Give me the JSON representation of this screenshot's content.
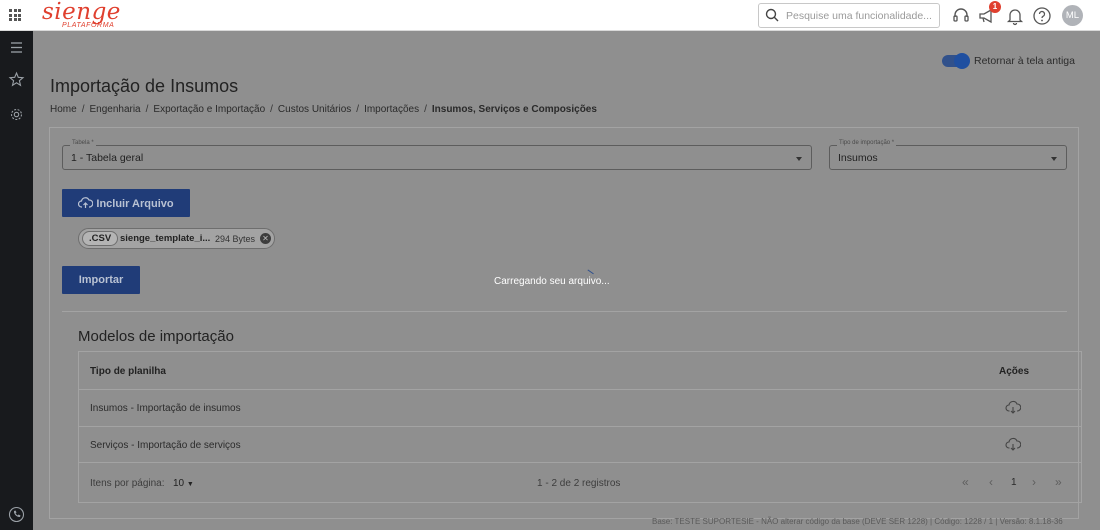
{
  "topbar": {
    "logo": "sienge",
    "logo_sub": "PLATAFORMA",
    "search_placeholder": "Pesquise uma funcionalidade...",
    "notification_count": "1",
    "avatar_initials": "ML"
  },
  "toggle_label": "Retornar à tela antiga",
  "page_title": "Importação de Insumos",
  "breadcrumb": {
    "items": [
      "Home",
      "Engenharia",
      "Exportação e Importação",
      "Custos Unitários",
      "Importações"
    ],
    "current": "Insumos, Serviços e Composições"
  },
  "form": {
    "tabela_label": "Tabela *",
    "tabela_value": "1 - Tabela geral",
    "tipo_label": "Tipo de importação *",
    "tipo_value": "Insumos",
    "incluir_label": "Incluir Arquivo",
    "importar_label": "Importar"
  },
  "file_chip": {
    "ext": ".CSV",
    "name": "sienge_template_i...",
    "size": "294 Bytes"
  },
  "loading_text": "Carregando seu arquivo...",
  "models": {
    "title": "Modelos de importação",
    "col_tipo": "Tipo de planilha",
    "col_acoes": "Ações",
    "rows": [
      {
        "tipo": "Insumos - Importação de insumos"
      },
      {
        "tipo": "Serviços - Importação de serviços"
      }
    ],
    "items_per_page_label": "Itens por página:",
    "items_per_page_value": "10",
    "range_text": "1 - 2 de 2 registros",
    "current_page": "1"
  },
  "status_bar": "Base: TESTE SUPORTESIE - NÃO alterar código da base (DEVE SER 1228) | Código: 1228 / 1 | Versão: 8.1.18-36",
  "colors": {
    "brand": "#e0402f",
    "primary_button": "#203c78",
    "sidebar": "#181a1d",
    "overlay": "#8f8f8f"
  }
}
